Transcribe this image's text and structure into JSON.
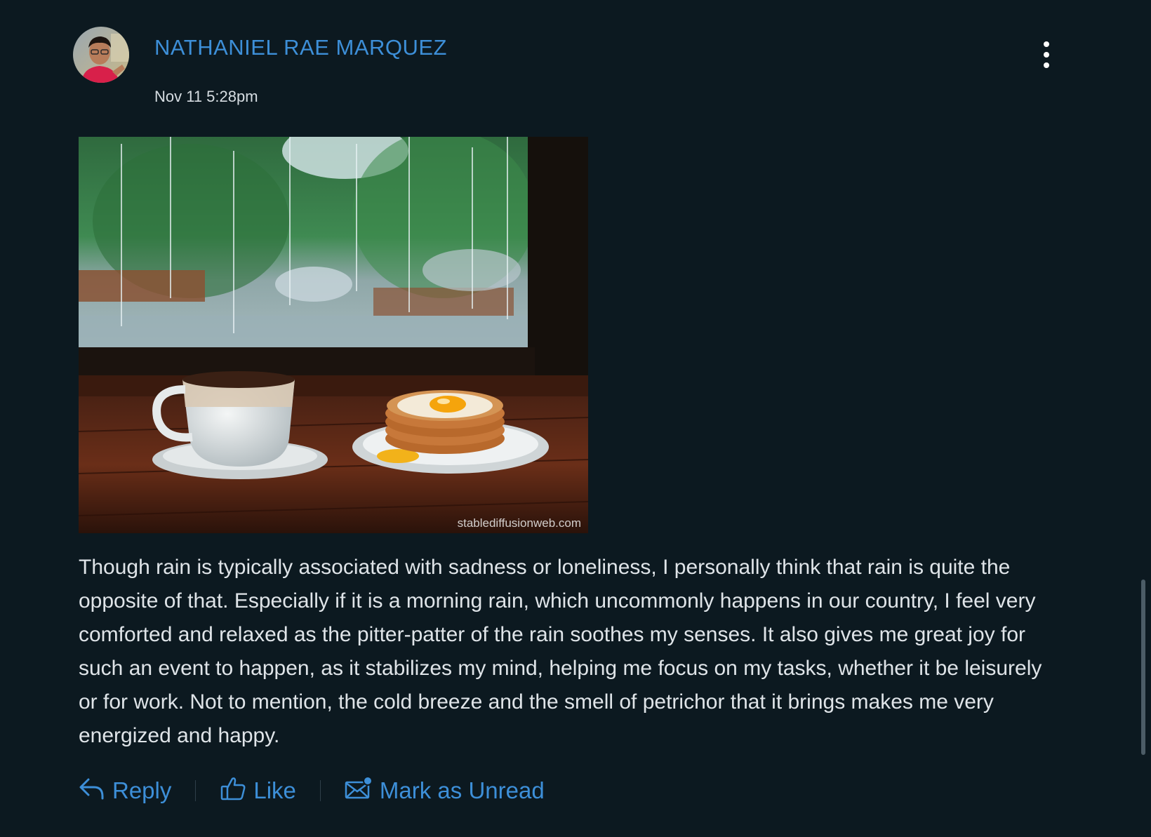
{
  "post": {
    "author": "NATHANIEL RAE MARQUEZ",
    "timestamp": "Nov 11 5:28pm",
    "image_caption": "stablediffusionweb.com",
    "body": "Though rain is typically associated with sadness or loneliness, I personally think that rain is quite the opposite of that. Especially if it is a morning rain, which uncommonly happens in our country, I feel very comforted and relaxed as the pitter-patter of the rain soothes my senses. It also gives me great joy for such an event to happen, as it stabilizes my mind, helping me focus on my tasks, whether it be leisurely or for work. Not to mention, the cold breeze and the smell of petrichor that it brings makes me very energized and happy."
  },
  "actions": {
    "reply": "Reply",
    "like": "Like",
    "mark_unread": "Mark as Unread"
  },
  "icons": {
    "avatar": "avatar",
    "more": "more-vertical-icon",
    "reply": "reply-arrow-icon",
    "like": "thumbs-up-icon",
    "mark_unread": "envelope-dot-icon"
  },
  "colors": {
    "background": "#0c1920",
    "accent": "#3d8fd8",
    "text": "#dfe4e8"
  }
}
